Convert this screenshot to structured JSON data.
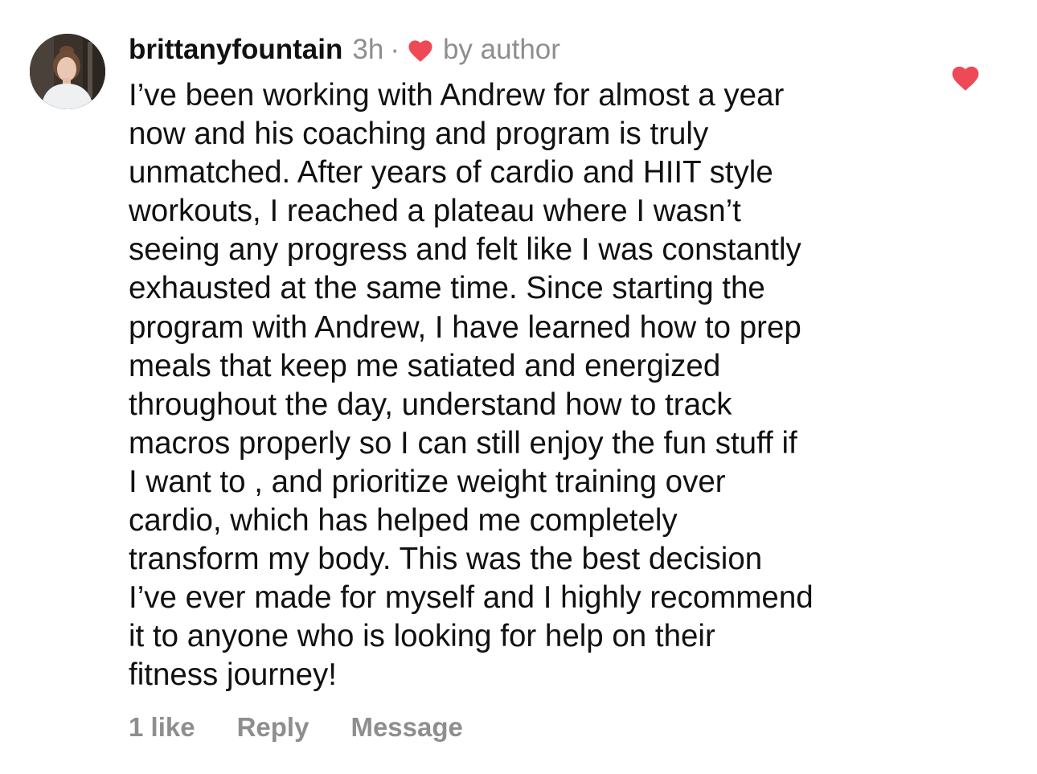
{
  "comment": {
    "username": "brittanyfountain",
    "time": "3h",
    "separator": "·",
    "author_badge": "by author",
    "text": "I’ve been working with Andrew for almost a year\nnow and his coaching and program is truly\nunmatched. After years of cardio and HIIT style\nworkouts, I reached a plateau where I wasn’t\nseeing any progress and felt like I was constantly\nexhausted at the same time. Since starting the\nprogram with Andrew, I have learned how to prep\nmeals that keep me satiated and energized\nthroughout the day, understand how to track\nmacros properly so I can still enjoy the fun stuff if\nI want to , and prioritize weight training over\ncardio, which has helped me completely\ntransform my body. This was the best decision\nI’ve ever made for myself and I highly recommend\nit to anyone who is looking for help on their\nfitness journey!",
    "liked": true
  },
  "actions": {
    "likes": "1 like",
    "reply": "Reply",
    "message": "Message"
  },
  "icons": {
    "author_heart": "heart-icon",
    "like_heart": "heart-icon"
  },
  "colors": {
    "heart": "#ed4956",
    "muted": "#8e8e8e",
    "text": "#111111"
  }
}
